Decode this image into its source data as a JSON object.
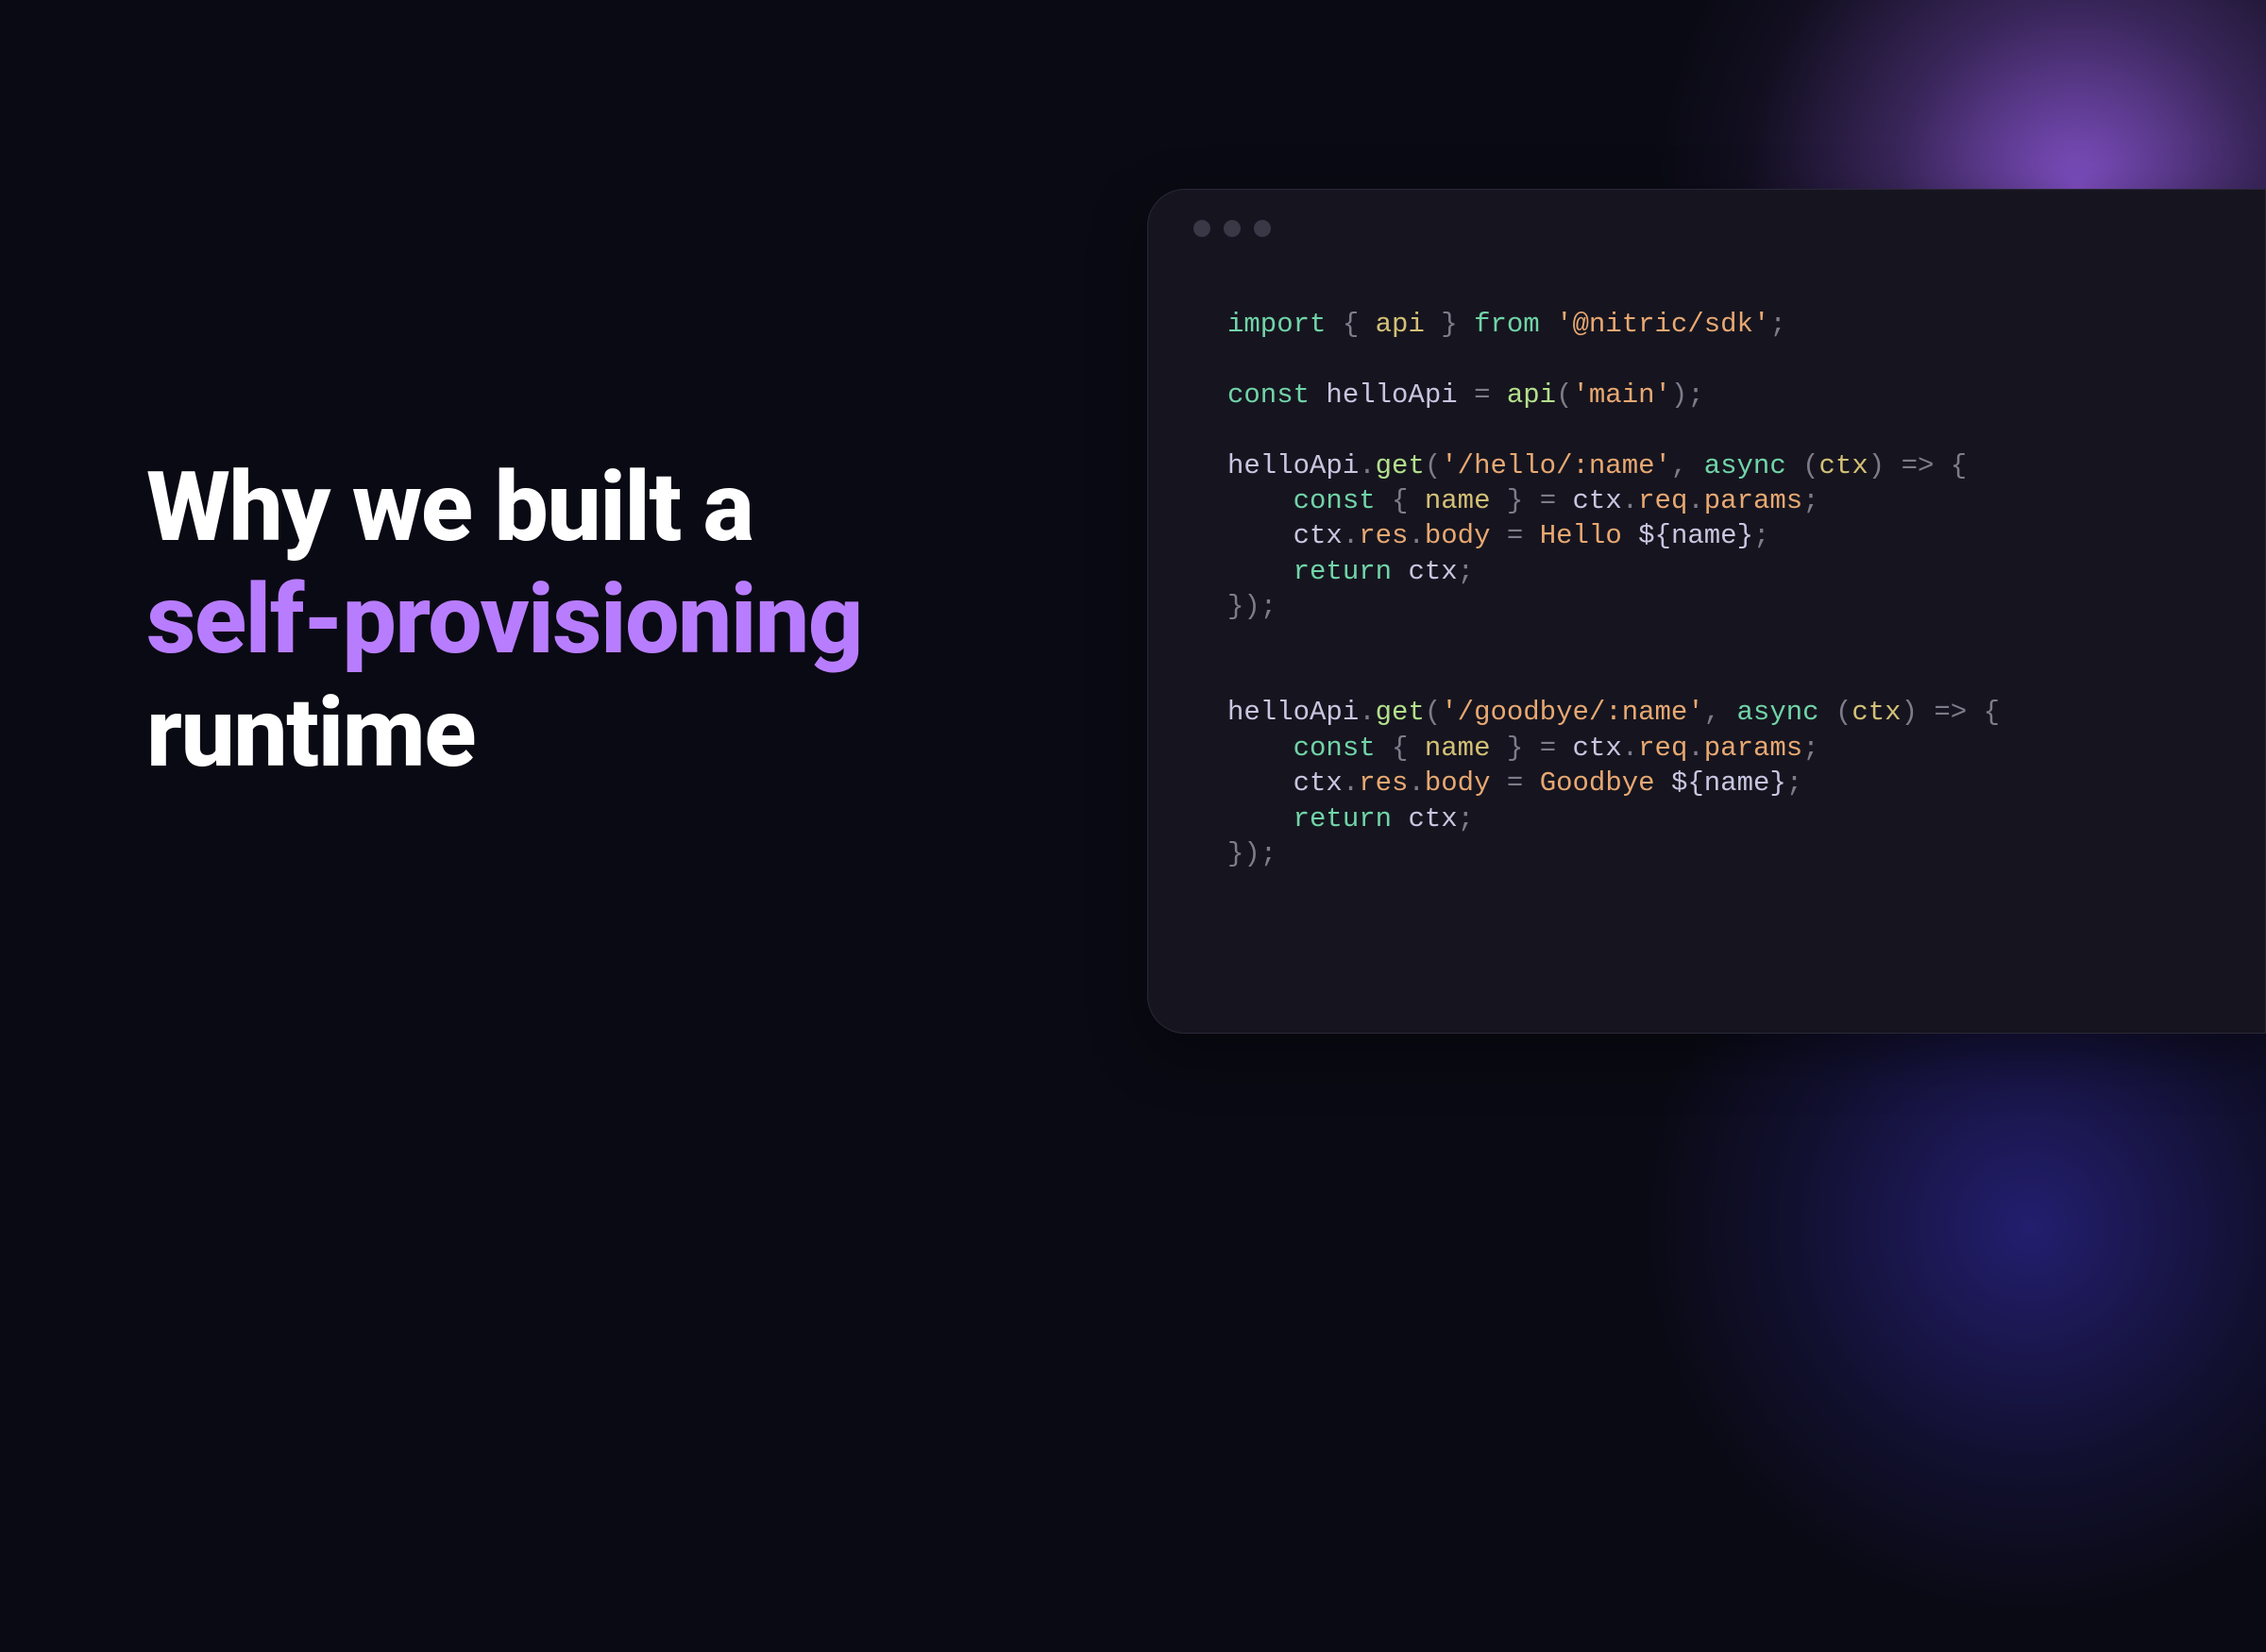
{
  "headline": {
    "line1": "Why we built a",
    "line2_accent": "self-provisioning",
    "line3": "runtime"
  },
  "colors": {
    "accent": "#b87dff",
    "keyword": "#71d4a8",
    "property_name": "#d3c077",
    "function": "#b4e08c",
    "string": "#e8a872",
    "property_access": "#e8a872",
    "variable": "#c9c5e0",
    "punctuation": "#7e7c8a"
  },
  "code": {
    "t_import": "import",
    "t_from": "from",
    "t_const": "const",
    "t_async": "async",
    "t_return": "return",
    "lbrace": "{",
    "rbrace": "}",
    "lparen": "(",
    "rparen": ")",
    "semi": ";",
    "comma": ",",
    "eq": "=",
    "arrow": "=>",
    "dot": ".",
    "api_ident": "api",
    "pkg_nitric": "'@nitric/sdk'",
    "helloApi": "helloApi",
    "api_call": "api",
    "main_str": "'main'",
    "get": "get",
    "route_hello": "'/hello/:name'",
    "route_goodbye": "'/goodbye/:name'",
    "ctx": "ctx",
    "name": "name",
    "req": "req",
    "params": "params",
    "res": "res",
    "body": "body",
    "hello_word": "Hello",
    "goodbye_word": "Goodbye",
    "tpl_open": "${",
    "tpl_close": "}",
    "close_block": "});",
    "indent": "    "
  }
}
